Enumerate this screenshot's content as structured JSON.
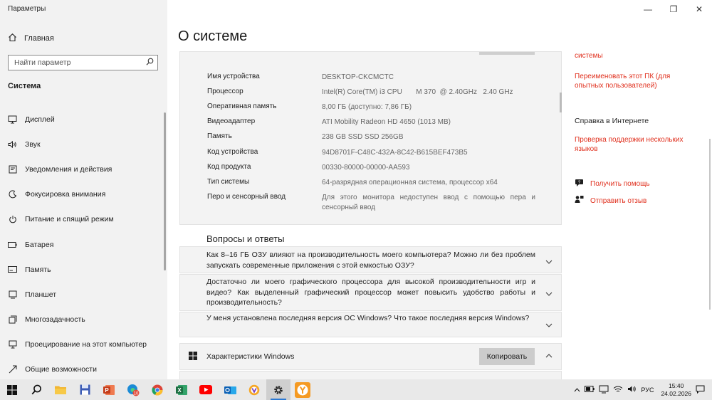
{
  "window": {
    "title": "Параметры",
    "controls": {
      "minimize": "—",
      "maximize": "❐",
      "close": "✕"
    }
  },
  "sidebar": {
    "home": "Главная",
    "search_placeholder": "Найти параметр",
    "section": "Система",
    "items": [
      {
        "label": "Дисплей",
        "icon": "display-icon"
      },
      {
        "label": "Звук",
        "icon": "sound-icon"
      },
      {
        "label": "Уведомления и действия",
        "icon": "notifications-icon"
      },
      {
        "label": "Фокусировка внимания",
        "icon": "focus-assist-icon"
      },
      {
        "label": "Питание и спящий режим",
        "icon": "power-icon"
      },
      {
        "label": "Батарея",
        "icon": "battery-icon"
      },
      {
        "label": "Память",
        "icon": "storage-icon"
      },
      {
        "label": "Планшет",
        "icon": "tablet-icon"
      },
      {
        "label": "Многозадачность",
        "icon": "multitasking-icon"
      },
      {
        "label": "Проецирование на этот компьютер",
        "icon": "projecting-icon"
      },
      {
        "label": "Общие возможности",
        "icon": "shared-experiences-icon"
      }
    ]
  },
  "main": {
    "title": "О системе",
    "specs": [
      {
        "label": "Имя устройства",
        "value": "DESKTOP-CKCMCTC"
      },
      {
        "label": "Процессор",
        "value": "Intel(R) Core(TM) i3 CPU       M 370  @ 2.40GHz   2.40 GHz"
      },
      {
        "label": "Оперативная память",
        "value": "8,00 ГБ (доступно: 7,86 ГБ)"
      },
      {
        "label": "Видеоадаптер",
        "value": "ATI Mobility Radeon HD 4650 (1013 MB)"
      },
      {
        "label": "Память",
        "value": "238 GB SSD SSD 256GB"
      },
      {
        "label": "Код устройства",
        "value": "94D8701F-C48C-432A-8C42-B615BEF473B5"
      },
      {
        "label": "Код продукта",
        "value": "00330-80000-00000-AA593"
      },
      {
        "label": "Тип системы",
        "value": "64-разрядная операционная система, процессор x64"
      },
      {
        "label": "Перо и сенсорный ввод",
        "value": "Для этого монитора недоступен ввод с помощью пера и сенсорный ввод"
      }
    ],
    "faq_title": "Вопросы и ответы",
    "faq": [
      "Как 8–16 ГБ ОЗУ влияют на производительность моего компьютера? Можно ли без проблем запускать современные приложения с этой емкостью ОЗУ?",
      "Достаточно ли моего графического процессора для высокой производительности игр и видео? Как выделенный графический процессор может повысить удобство работы и производительность?",
      "У меня установлена последняя версия ОС Windows? Что такое последняя версия Windows?"
    ],
    "windows_specs_label": "Характеристики Windows",
    "copy_label": "Копировать"
  },
  "right": {
    "link_top": "системы",
    "link_rename": "Переименовать этот ПК (для опытных пользователей)",
    "help_heading": "Справка в Интернете",
    "link_support": "Проверка поддержки нескольких языков",
    "get_help": "Получить помощь",
    "feedback": "Отправить отзыв"
  },
  "taskbar": {
    "apps": [
      "start-icon",
      "search-icon",
      "file-explorer-icon",
      "save-icon",
      "powerpoint-icon",
      "edge-icon",
      "chrome-icon",
      "excel-icon",
      "youtube-icon",
      "outlook-icon",
      "browser-icon",
      "settings-icon",
      "yandex-icon"
    ],
    "edge_badge": "10",
    "lang": "РУС",
    "time": "15:40",
    "date": "24.02.2026"
  },
  "colors": {
    "accent_link": "#e0301e",
    "taskbar_active": "#2b79d3"
  }
}
